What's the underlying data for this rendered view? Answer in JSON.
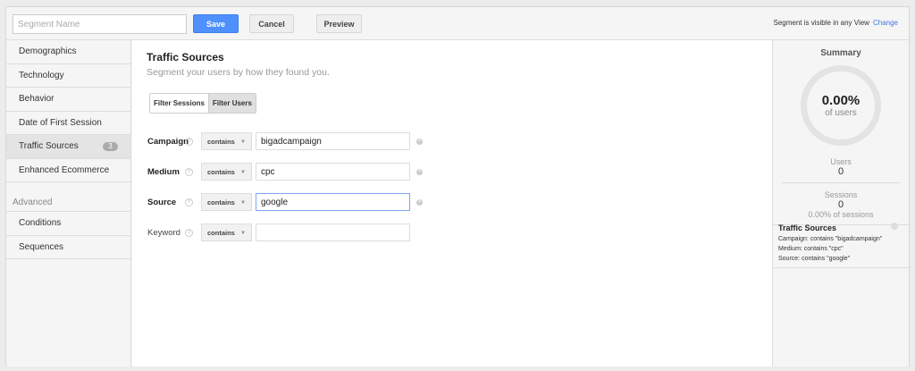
{
  "header": {
    "segment_name_placeholder": "Segment Name",
    "segment_name_value": "",
    "save": "Save",
    "cancel": "Cancel",
    "preview": "Preview",
    "visibility_text": "Segment is visible in any View",
    "change_link": "Change"
  },
  "sidebar": {
    "items": [
      {
        "label": "Demographics"
      },
      {
        "label": "Technology"
      },
      {
        "label": "Behavior"
      },
      {
        "label": "Date of First Session"
      },
      {
        "label": "Traffic Sources",
        "badge": "3",
        "active": true
      },
      {
        "label": "Enhanced Ecommerce"
      }
    ],
    "advanced_label": "Advanced",
    "advanced_items": [
      {
        "label": "Conditions"
      },
      {
        "label": "Sequences"
      }
    ]
  },
  "main": {
    "title": "Traffic Sources",
    "subtitle": "Segment your users by how they found you.",
    "filter_sessions": "Filter Sessions",
    "filter_users": "Filter Users",
    "selected_filter": "Filter Users",
    "rows": [
      {
        "label": "Campaign",
        "operator": "contains",
        "value": "bigadcampaign"
      },
      {
        "label": "Medium",
        "operator": "contains",
        "value": "cpc"
      },
      {
        "label": "Source",
        "operator": "contains",
        "value": "google"
      },
      {
        "label": "Keyword",
        "operator": "contains",
        "value": ""
      }
    ],
    "help_glyph": "?"
  },
  "summary": {
    "title": "Summary",
    "percent": "0.00%",
    "of_users": "of users",
    "users_label": "Users",
    "users_value": "0",
    "sessions_label": "Sessions",
    "sessions_value": "0",
    "sessions_pct": "0.00% of sessions",
    "conditions_title": "Traffic Sources",
    "conditions": [
      "Campaign: contains \"bigadcampaign\"",
      "Medium: contains \"cpc\"",
      "Source: contains \"google\""
    ]
  },
  "colors": {
    "accent": "#4d90fe",
    "link": "#3b78e7"
  }
}
